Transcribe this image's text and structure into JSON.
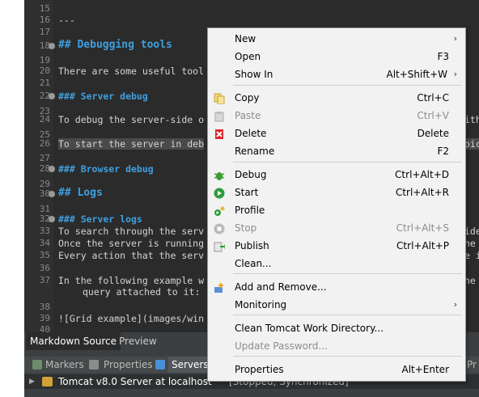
{
  "editor": {
    "lines": [
      {
        "n": "15",
        "text": "",
        "cls": ""
      },
      {
        "n": "16",
        "text": "---",
        "cls": ""
      },
      {
        "n": "17",
        "text": "",
        "cls": ""
      },
      {
        "n": "18",
        "text": "## Debugging tools",
        "cls": "h2",
        "fold": true
      },
      {
        "n": "19",
        "text": "",
        "cls": ""
      },
      {
        "n": "20",
        "text": "There are some useful tool",
        "cls": ""
      },
      {
        "n": "21",
        "text": "",
        "cls": ""
      },
      {
        "n": "22",
        "text": "### Server debug",
        "cls": "h3",
        "fold": true
      },
      {
        "n": "23",
        "text": "",
        "cls": ""
      },
      {
        "n": "24",
        "text": "To debug the server-side o",
        "cls": ""
      },
      {
        "n": "25",
        "text": "",
        "cls": ""
      },
      {
        "n": "26",
        "text": "To start the server in deb",
        "cls": "hl"
      },
      {
        "n": "27",
        "text": "",
        "cls": ""
      },
      {
        "n": "28",
        "text": "### Browser debug",
        "cls": "h3",
        "fold": true
      },
      {
        "n": "29",
        "text": "",
        "cls": ""
      },
      {
        "n": "30",
        "text": "## Logs",
        "cls": "h2",
        "fold": true
      },
      {
        "n": "31",
        "text": "",
        "cls": ""
      },
      {
        "n": "32",
        "text": "### Server logs",
        "cls": "h3",
        "fold": true
      },
      {
        "n": "33",
        "text": "To search through the serv",
        "cls": ""
      },
      {
        "n": "34",
        "text": "Once the server is running",
        "cls": ""
      },
      {
        "n": "35",
        "text": "Every action that the serv",
        "cls": ""
      },
      {
        "n": "36",
        "text": "",
        "cls": ""
      },
      {
        "n": "37",
        "text": "In the following example w",
        "cls": ""
      },
      {
        "n": "",
        "text": "query attached to it:",
        "cls": "cont"
      },
      {
        "n": "38",
        "text": "",
        "cls": ""
      },
      {
        "n": "39",
        "text": "![Grid example](images/win",
        "cls": ""
      },
      {
        "n": "40",
        "text": "",
        "cls": ""
      }
    ],
    "right_peek": [
      {
        "line": "24",
        "text": "ith"
      },
      {
        "line": "26",
        "text": "pic"
      },
      {
        "line": "33",
        "text": "ide"
      },
      {
        "line": "34",
        "text": "he"
      },
      {
        "line": "35",
        "text": "e i"
      },
      {
        "line": "37",
        "text": "he"
      }
    ]
  },
  "md_tabs": {
    "source": "Markdown Source",
    "preview": "Preview"
  },
  "bottom_tabs": {
    "markers": "Markers",
    "properties": "Properties",
    "servers": "Servers",
    "right_label": "Pr"
  },
  "server_row": {
    "name": "Tomcat v8.0 Server at localhost",
    "status": "[Stopped, Synchronized]"
  },
  "menu": {
    "items": [
      {
        "label": "New",
        "shortcut": "",
        "submenu": true,
        "disabled": false,
        "icon": ""
      },
      {
        "label": "Open",
        "shortcut": "F3",
        "submenu": false,
        "disabled": false,
        "icon": ""
      },
      {
        "label": "Show In",
        "shortcut": "Alt+Shift+W",
        "submenu": true,
        "disabled": false,
        "icon": ""
      },
      {
        "label": "Copy",
        "shortcut": "Ctrl+C",
        "submenu": false,
        "disabled": false,
        "icon": "copy-icon"
      },
      {
        "label": "Paste",
        "shortcut": "Ctrl+V",
        "submenu": false,
        "disabled": true,
        "icon": "paste-icon"
      },
      {
        "label": "Delete",
        "shortcut": "Delete",
        "submenu": false,
        "disabled": false,
        "icon": "delete-icon"
      },
      {
        "label": "Rename",
        "shortcut": "F2",
        "submenu": false,
        "disabled": false,
        "icon": ""
      },
      {
        "label": "Debug",
        "shortcut": "Ctrl+Alt+D",
        "submenu": false,
        "disabled": false,
        "icon": "debug-bug-icon"
      },
      {
        "label": "Start",
        "shortcut": "Ctrl+Alt+R",
        "submenu": false,
        "disabled": false,
        "icon": "start-icon"
      },
      {
        "label": "Profile",
        "shortcut": "",
        "submenu": false,
        "disabled": false,
        "icon": "profile-icon"
      },
      {
        "label": "Stop",
        "shortcut": "Ctrl+Alt+S",
        "submenu": false,
        "disabled": true,
        "icon": "stop-icon"
      },
      {
        "label": "Publish",
        "shortcut": "Ctrl+Alt+P",
        "submenu": false,
        "disabled": false,
        "icon": "publish-icon"
      },
      {
        "label": "Clean...",
        "shortcut": "",
        "submenu": false,
        "disabled": false,
        "icon": ""
      },
      {
        "label": "Add and Remove...",
        "shortcut": "",
        "submenu": false,
        "disabled": false,
        "icon": "add-remove-icon"
      },
      {
        "label": "Monitoring",
        "shortcut": "",
        "submenu": true,
        "disabled": false,
        "icon": ""
      },
      {
        "label": "Clean Tomcat Work Directory...",
        "shortcut": "",
        "submenu": false,
        "disabled": false,
        "icon": ""
      },
      {
        "label": "Update Password...",
        "shortcut": "",
        "submenu": false,
        "disabled": true,
        "icon": ""
      },
      {
        "label": "Properties",
        "shortcut": "Alt+Enter",
        "submenu": false,
        "disabled": false,
        "icon": ""
      }
    ]
  },
  "colors": {
    "editor_bg": "#2b2b2b",
    "heading": "#3f9fe0",
    "menu_bg": "#f2f2f2",
    "disabled_text": "#8d8d8d"
  }
}
